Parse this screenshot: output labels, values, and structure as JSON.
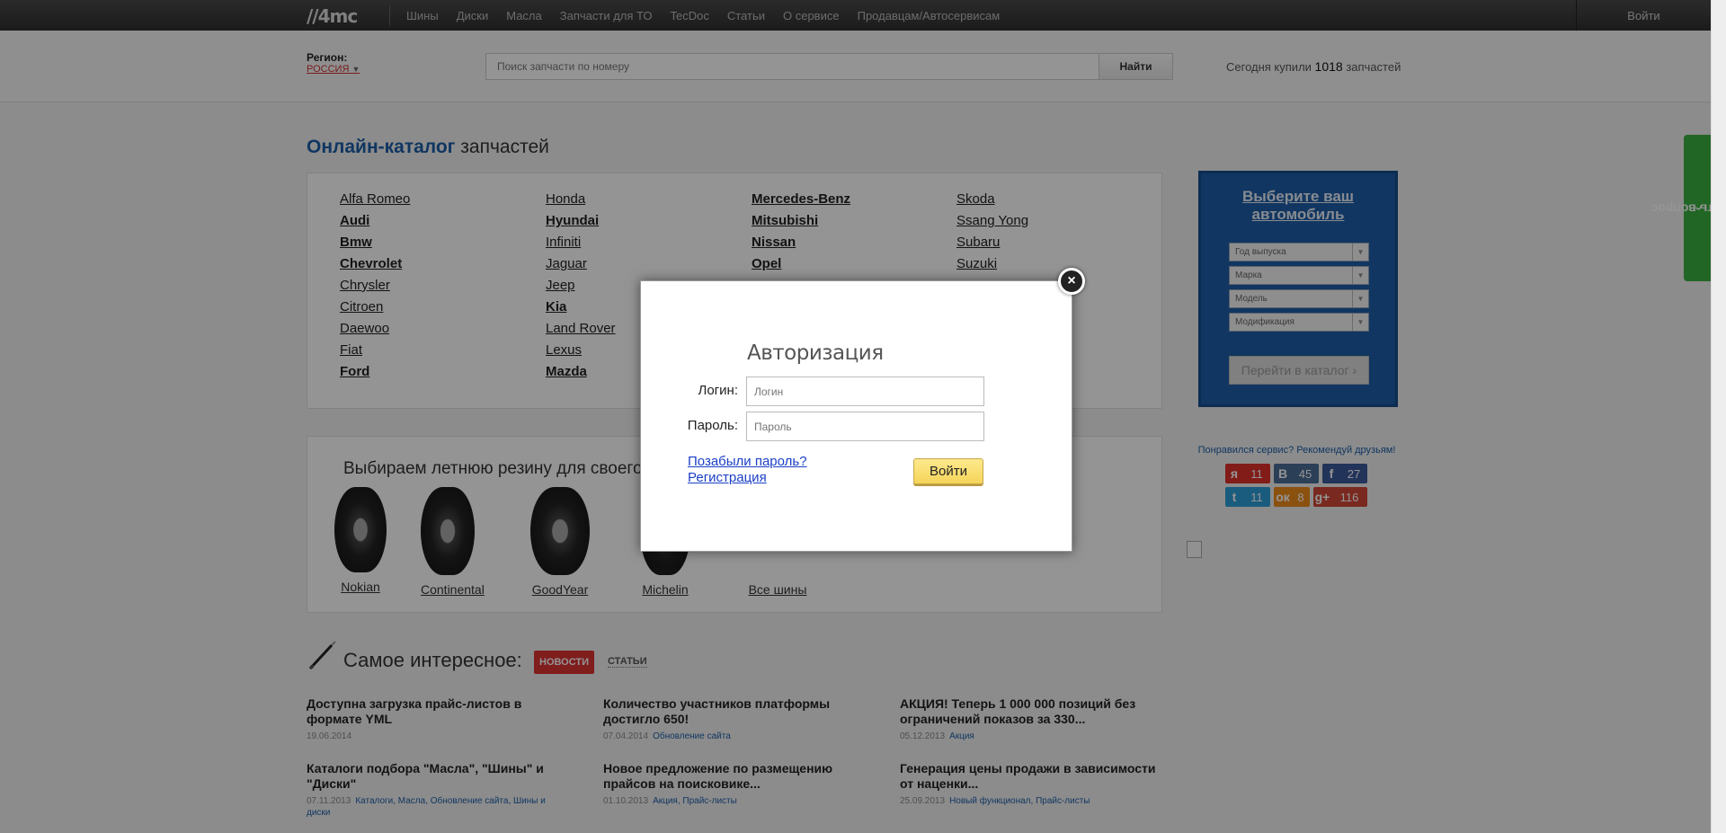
{
  "topbar": {
    "logo": "//4mc",
    "nav": [
      "Шины",
      "Диски",
      "Масла",
      "Запчасти для ТО",
      "TecDoc",
      "Статьи",
      "О сервисе",
      "Продавцам/Автосервисам"
    ],
    "login": "Войти"
  },
  "search": {
    "region_label": "Регион:",
    "region_value": "РОССИЯ",
    "placeholder": "Поиск запчасти по номеру",
    "button": "Найти",
    "bought_prefix": "Сегодня купили",
    "bought_count": "1018",
    "bought_suffix": "запчастей"
  },
  "catalog": {
    "title_accent": "Онлайн-каталог",
    "title_rest": "запчастей",
    "columns": [
      [
        {
          "name": "Alfa Romeo",
          "bold": false
        },
        {
          "name": "Audi",
          "bold": true
        },
        {
          "name": "Bmw",
          "bold": true
        },
        {
          "name": "Chevrolet",
          "bold": true
        },
        {
          "name": "Chrysler",
          "bold": false
        },
        {
          "name": "Citroen",
          "bold": false
        },
        {
          "name": "Daewoo",
          "bold": false
        },
        {
          "name": "Fiat",
          "bold": false
        },
        {
          "name": "Ford",
          "bold": true
        }
      ],
      [
        {
          "name": "Honda",
          "bold": false
        },
        {
          "name": "Hyundai",
          "bold": true
        },
        {
          "name": "Infiniti",
          "bold": false
        },
        {
          "name": "Jaguar",
          "bold": false
        },
        {
          "name": "Jeep",
          "bold": false
        },
        {
          "name": "Kia",
          "bold": true
        },
        {
          "name": "Land Rover",
          "bold": false
        },
        {
          "name": "Lexus",
          "bold": false
        },
        {
          "name": "Mazda",
          "bold": true
        }
      ],
      [
        {
          "name": "Mercedes-Benz",
          "bold": true
        },
        {
          "name": "Mitsubishi",
          "bold": true
        },
        {
          "name": "Nissan",
          "bold": true
        },
        {
          "name": "Opel",
          "bold": true
        }
      ],
      [
        {
          "name": "Skoda",
          "bold": false
        },
        {
          "name": "Ssang Yong",
          "bold": false
        },
        {
          "name": "Subaru",
          "bold": false
        },
        {
          "name": "Suzuki",
          "bold": false
        }
      ]
    ]
  },
  "car_select": {
    "title": "Выберите ваш автомобиль",
    "year": "Год выпуска",
    "make": "Марка",
    "model": "Модель",
    "modification": "Модификация",
    "go": "Перейти в каталог"
  },
  "social": {
    "recommend": "Понравился сервис? Рекомендуй друзьям!",
    "buttons": [
      {
        "icon": "я",
        "count": "11",
        "color": "#e0312b"
      },
      {
        "icon": "В",
        "count": "45",
        "color": "#4a6d96"
      },
      {
        "icon": "f",
        "count": "27",
        "color": "#3b5a9a"
      },
      {
        "icon": "t",
        "count": "11",
        "color": "#2d9fd9"
      },
      {
        "icon": "ок",
        "count": "8",
        "color": "#f08c1a"
      },
      {
        "icon": "g+",
        "count": "116",
        "color": "#d14836"
      }
    ]
  },
  "feedback": "Задать вопрос",
  "tires": {
    "title": "Выбираем летнюю резину для своего а",
    "brands": [
      "Nokian",
      "Continental",
      "GoodYear",
      "Michelin",
      "Все шины"
    ]
  },
  "news": {
    "title": "Самое интересное:",
    "tag_news": "НОВОСТИ",
    "tag_articles": "СТАТЬИ",
    "items": [
      {
        "title": "Доступна загрузка прайс-листов в формате YML",
        "date": "19.06.2014",
        "cats": ""
      },
      {
        "title": "Количество участников платформы достигло 650!",
        "date": "07.04.2014",
        "cats": "Обновление сайта"
      },
      {
        "title": "АКЦИЯ! Теперь 1 000 000 позиций без ограничений показов за 330...",
        "date": "05.12.2013",
        "cats": "Акция"
      },
      {
        "title": "Каталоги подбора \"Масла\", \"Шины\" и \"Диски\"",
        "date": "07.11.2013",
        "cats": "Каталоги,  Масла,  Обновление сайта,  Шины и диски"
      },
      {
        "title": "Новое предложение по размещению прайсов на поисковике...",
        "date": "01.10.2013",
        "cats": "Акция,  Прайс-листы"
      },
      {
        "title": "Генерация цены продажи в зависимости от наценки...",
        "date": "25.09.2013",
        "cats": "Новый функционал,  Прайс-листы"
      }
    ]
  },
  "modal": {
    "title": "Авторизация",
    "login_label": "Логин:",
    "login_placeholder": "Логин",
    "password_label": "Пароль:",
    "password_placeholder": "Пароль",
    "forgot": "Позабыли пароль?",
    "register": "Регистрация",
    "submit": "Войти",
    "close": "×"
  }
}
